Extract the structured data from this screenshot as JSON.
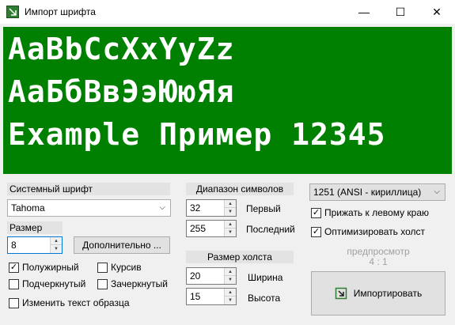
{
  "window": {
    "title": "Импорт шрифта",
    "minimize": "—",
    "maximize": "☐",
    "close": "✕"
  },
  "preview": {
    "background": "#008000",
    "lines": [
      "AaBbCcXxYyZz",
      "АаБбВвЭэЮюЯя",
      "Example Пример 12345"
    ]
  },
  "system_font": {
    "header": "Системный шрифт",
    "font_name": "Tahoma",
    "size_label": "Размер",
    "size_value": "8",
    "advanced_button": "Дополнительно ..."
  },
  "styles": {
    "bold": {
      "label": "Полужирный",
      "checked": true
    },
    "italic": {
      "label": "Курсив",
      "checked": false
    },
    "underline": {
      "label": "Подчеркнутый",
      "checked": false
    },
    "strikeout": {
      "label": "Зачеркнутый",
      "checked": false
    },
    "change_sample": {
      "label": "Изменить текст образца",
      "checked": false
    }
  },
  "char_range": {
    "header": "Диапазон символов",
    "first_value": "32",
    "first_label": "Первый",
    "last_value": "255",
    "last_label": "Последний"
  },
  "canvas_size": {
    "header": "Размер холста",
    "width_value": "20",
    "width_label": "Ширина",
    "height_value": "15",
    "height_label": "Высота"
  },
  "codepage": {
    "selected": "1251 (ANSI - кириллица)"
  },
  "options": {
    "align_left": {
      "label": "Прижать к левому краю",
      "checked": true
    },
    "optimize_canvas": {
      "label": "Оптимизировать холст",
      "checked": true
    }
  },
  "preview_scale": {
    "label": "предпросмотр",
    "value": "4 : 1"
  },
  "import_button": "Импортировать"
}
